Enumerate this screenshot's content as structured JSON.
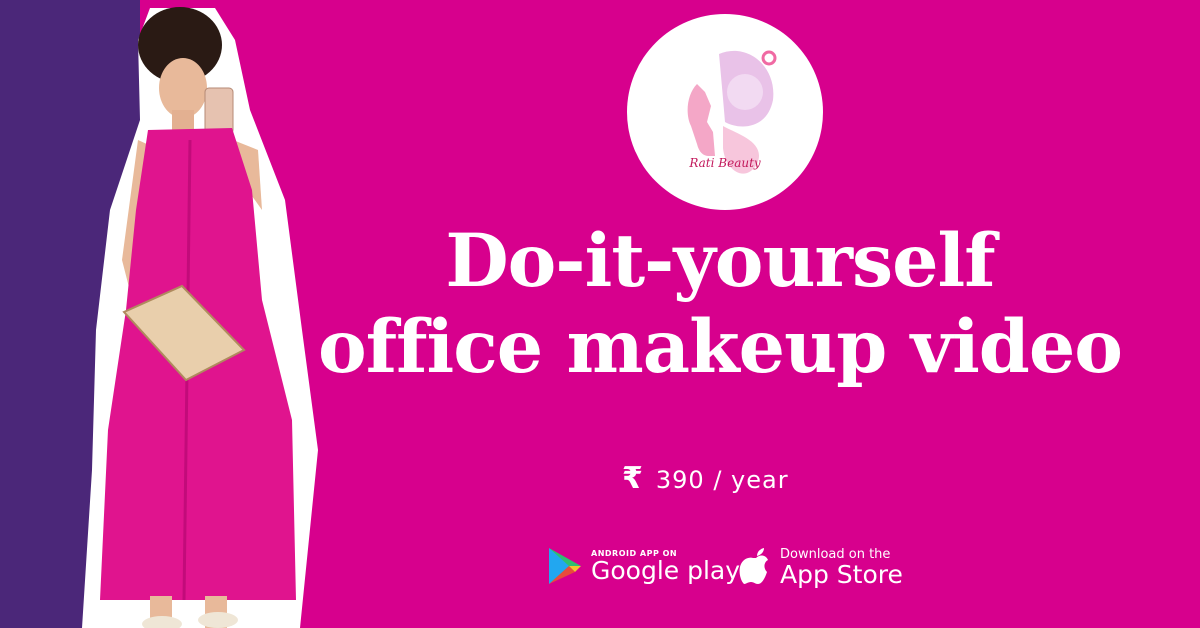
{
  "title": {
    "line1": "Do-it-yourself",
    "line2": "office makeup video"
  },
  "logo": {
    "text": "Rati Beauty"
  },
  "price": {
    "symbol": "₹",
    "text": "390 / year"
  },
  "stores": {
    "google": {
      "small": "ANDROID APP ON",
      "big": "Google play",
      "icon": "play-triangle-icon"
    },
    "apple": {
      "small": "Download on the",
      "big": "App Store",
      "icon": "apple-icon"
    }
  },
  "colors": {
    "background": "#d7008d",
    "left_strip": "#4b2779",
    "text": "#ffffff"
  }
}
